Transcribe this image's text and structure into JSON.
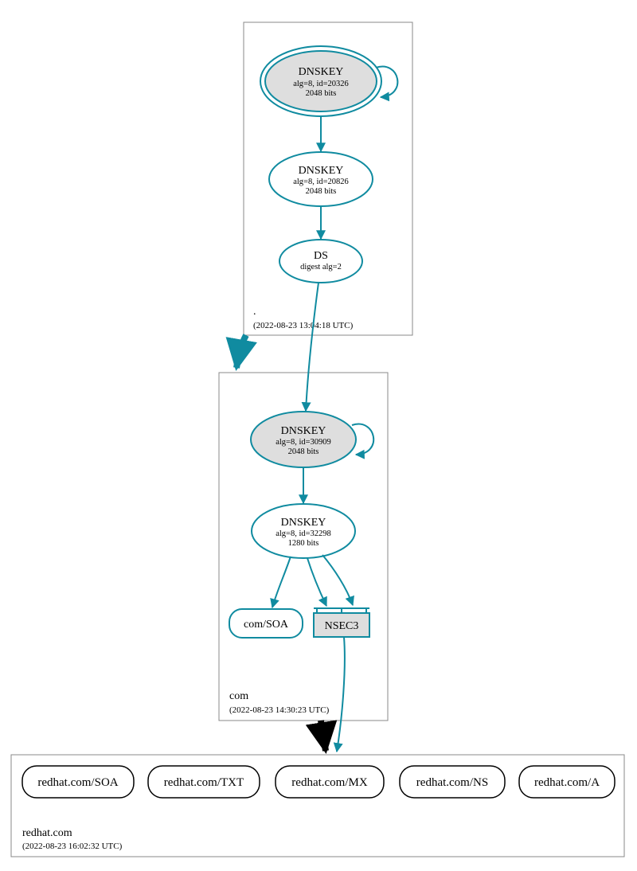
{
  "colors": {
    "teal": "#108ba0",
    "node_grey": "#dedede"
  },
  "zones": {
    "root": {
      "name": ".",
      "timestamp": "(2022-08-23 13:04:18 UTC)",
      "ksk": {
        "title": "DNSKEY",
        "line2": "alg=8, id=20326",
        "line3": "2048 bits"
      },
      "zsk": {
        "title": "DNSKEY",
        "line2": "alg=8, id=20826",
        "line3": "2048 bits"
      },
      "ds": {
        "title": "DS",
        "line2": "digest alg=2"
      }
    },
    "com": {
      "name": "com",
      "timestamp": "(2022-08-23 14:30:23 UTC)",
      "ksk": {
        "title": "DNSKEY",
        "line2": "alg=8, id=30909",
        "line3": "2048 bits"
      },
      "zsk": {
        "title": "DNSKEY",
        "line2": "alg=8, id=32298",
        "line3": "1280 bits"
      },
      "soa": "com/SOA",
      "nsec3": "NSEC3"
    },
    "redhat": {
      "name": "redhat.com",
      "timestamp": "(2022-08-23 16:02:32 UTC)",
      "records": {
        "soa": "redhat.com/SOA",
        "txt": "redhat.com/TXT",
        "mx": "redhat.com/MX",
        "ns": "redhat.com/NS",
        "a": "redhat.com/A"
      }
    }
  }
}
